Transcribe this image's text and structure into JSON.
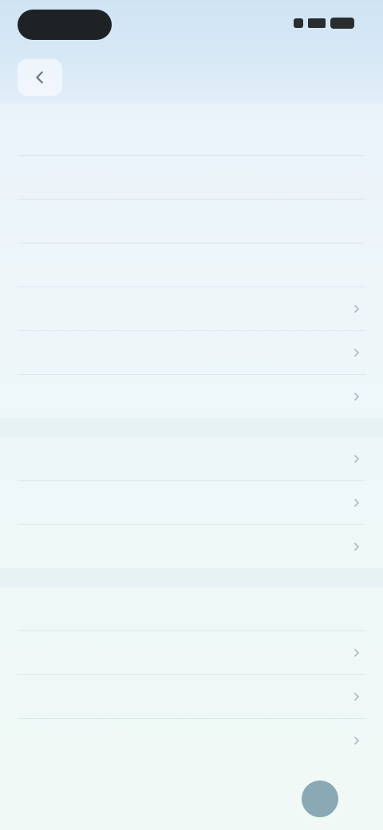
{
  "status_bar": {
    "pill": "",
    "icons": [
      "wifi-icon",
      "signal-icon",
      "battery-icon"
    ]
  },
  "nav": {
    "back_icon": "chevron-left-icon",
    "title": ""
  },
  "section1": {
    "rows": [
      {
        "label": "",
        "value": ""
      },
      {
        "label": "",
        "value": ""
      },
      {
        "label": "",
        "value": ""
      },
      {
        "label": "",
        "value": ""
      },
      {
        "label": "",
        "value": ""
      },
      {
        "label": "",
        "value": ""
      },
      {
        "label": "",
        "value": ""
      }
    ]
  },
  "section2": {
    "rows": [
      {
        "label": "",
        "value": ""
      },
      {
        "label": "",
        "value": ""
      },
      {
        "label": "",
        "value": ""
      }
    ]
  },
  "section3": {
    "rows": [
      {
        "label": "",
        "value": ""
      },
      {
        "label": "",
        "value": ""
      },
      {
        "label": "",
        "value": ""
      },
      {
        "label": "",
        "value": ""
      }
    ]
  },
  "footer": {
    "label": "",
    "icon": "avatar-circle-icon"
  },
  "colors": {
    "background_top": "#dcebf7",
    "background_bottom": "#f0f9f6",
    "status_pill": "#1f2225",
    "footer_circle": "#8aa9b4"
  }
}
